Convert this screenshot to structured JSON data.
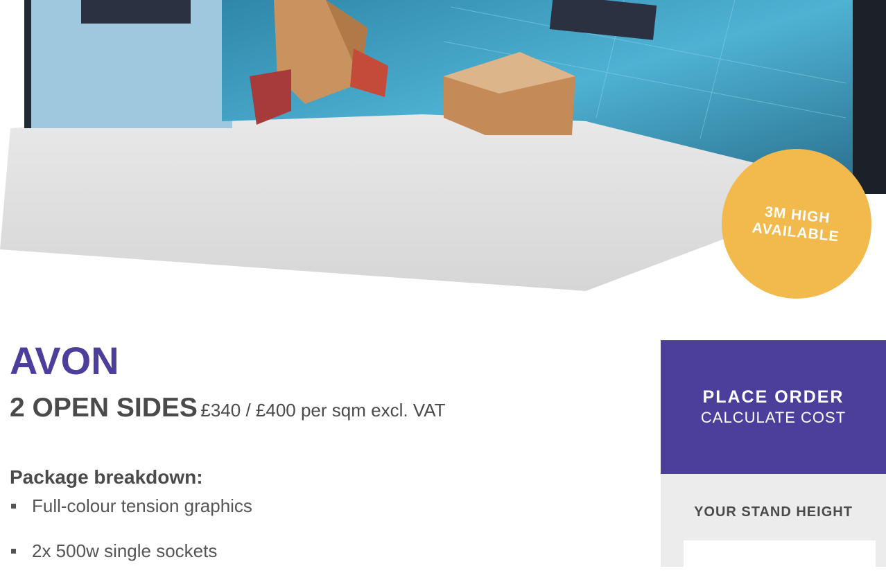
{
  "badge": {
    "text": "3M HIGH\nAVAILABLE"
  },
  "product": {
    "name": "AVON",
    "sides": "2 OPEN SIDES",
    "price": "£340 / £400 per sqm excl. VAT"
  },
  "breakdown": {
    "heading": "Package breakdown:",
    "items": [
      "Full-colour tension graphics",
      "2x 500w single sockets"
    ]
  },
  "order": {
    "title": "PLACE ORDER",
    "subtitle": "CALCULATE COST",
    "height_label": "YOUR STAND HEIGHT",
    "height_value": ""
  },
  "colors": {
    "brand_purple": "#4b3f9b",
    "badge_orange": "#f2b94c",
    "panel_grey": "#ececec"
  }
}
